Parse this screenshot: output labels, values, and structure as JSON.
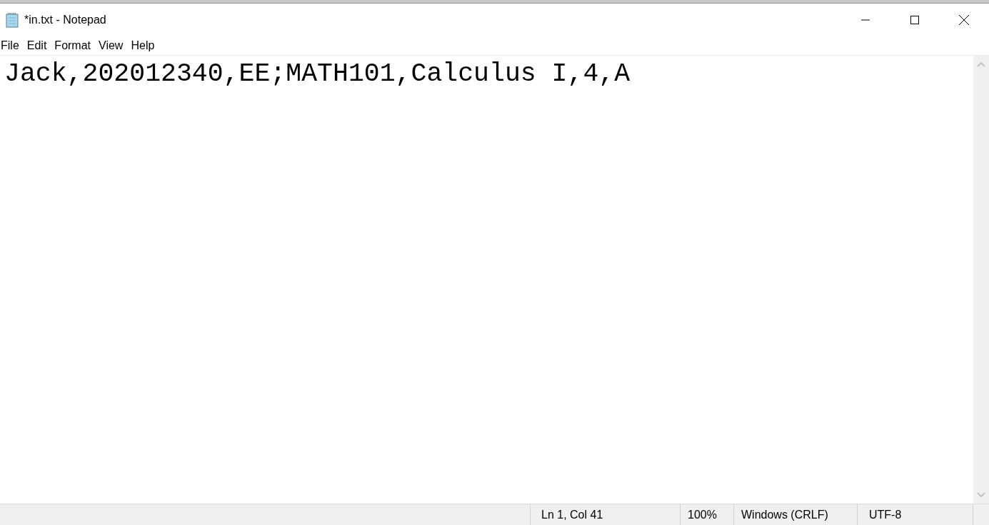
{
  "window": {
    "title": "*in.txt - Notepad"
  },
  "menu": [
    "File",
    "Edit",
    "Format",
    "View",
    "Help"
  ],
  "editor": {
    "text": "Jack,202012340,EE;MATH101,Calculus I,4,A"
  },
  "status_bar": [
    "Ln 1, Col 41",
    "100%",
    "Windows (CRLF)",
    "UTF-8"
  ]
}
